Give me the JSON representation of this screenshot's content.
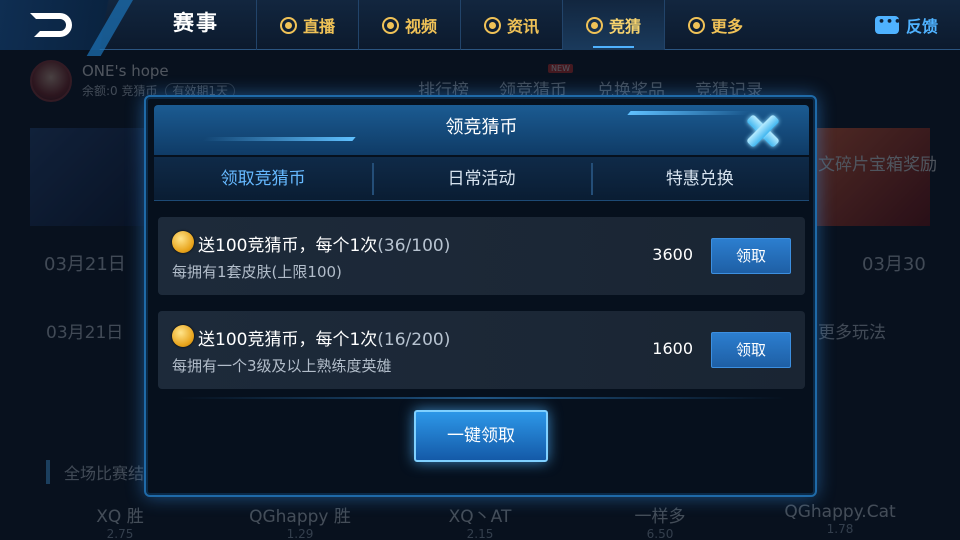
{
  "topbar": {
    "title": "赛事",
    "nav": [
      {
        "label": "直播",
        "icon": "live-icon"
      },
      {
        "label": "视频",
        "icon": "video-icon"
      },
      {
        "label": "资讯",
        "icon": "news-icon"
      },
      {
        "label": "竞猜",
        "icon": "quiz-icon",
        "active": true
      },
      {
        "label": "更多",
        "icon": "more-icon"
      }
    ],
    "feedback": "反馈"
  },
  "background": {
    "user_name": "ONE's hope",
    "balance": "余额:0 竞猜币",
    "valid": "有效期1天",
    "actions": [
      "排行榜",
      "领竞猜币",
      "兑换奖品",
      "竞猜记录"
    ],
    "new_badge": "NEW",
    "right_banner_text": "文碎片宝箱奖励",
    "dates": [
      "03月21日",
      "03月30",
      "03月21日"
    ],
    "more_play": "更多玩法",
    "all_matches": "全场比赛结",
    "teams": [
      {
        "name": "XQ 胜",
        "odd": "2.75"
      },
      {
        "name": "QGhappy 胜",
        "odd": "1.29"
      },
      {
        "name": "XQ丶AT",
        "odd": "2.15"
      },
      {
        "name": "一样多",
        "odd": "6.50"
      },
      {
        "name": "QGhappy.Cat",
        "odd": "1.78"
      }
    ]
  },
  "modal": {
    "title": "领竞猜币",
    "tabs": [
      "领取竞猜币",
      "日常活动",
      "特惠兑换"
    ],
    "rows": [
      {
        "title": "送100竞猜币，每个1次",
        "progress": "(36/100)",
        "desc": "每拥有1套皮肤(上限100)",
        "amount": "3600",
        "button": "领取"
      },
      {
        "title": "送100竞猜币，每个1次",
        "progress": "(16/200)",
        "desc": "每拥有一个3级及以上熟练度英雄",
        "amount": "1600",
        "button": "领取"
      }
    ],
    "one_key": "一键领取"
  },
  "colors": {
    "accent": "#66b9ff",
    "gold": "#f0c257",
    "button": "#1e5fa5"
  }
}
